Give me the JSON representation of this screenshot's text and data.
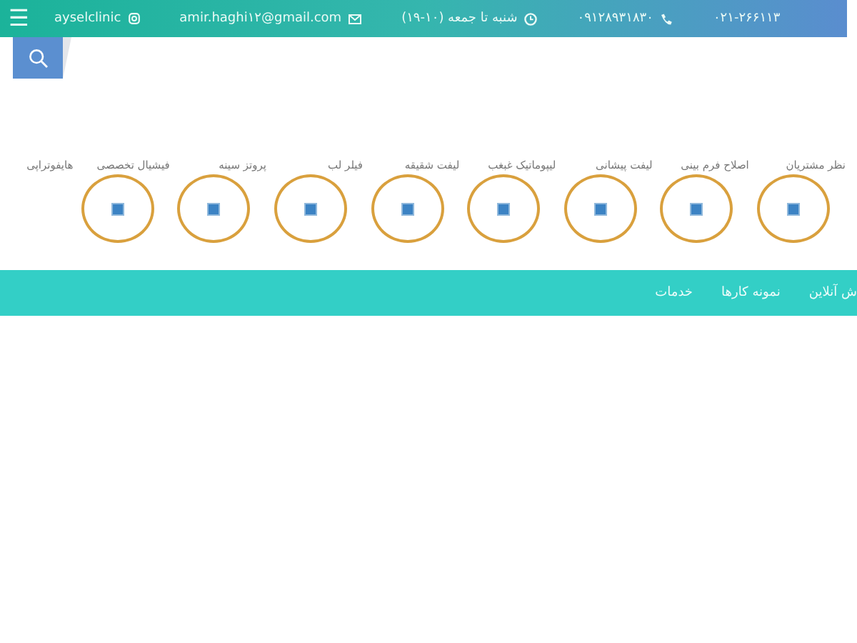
{
  "top_bar": {
    "menu": "☰",
    "instagram": "ayselclinic",
    "email": "amir.haghi۱۲@gmail.com",
    "hours": "شنبه تا جمعه (۱۰-۱۹)",
    "mobile": "۰۹۱۲۸۹۳۱۸۳۰",
    "phone": "۰۲۱-۲۶۶۱۱۳"
  },
  "services": [
    {
      "label": "نظر مشتریان",
      "kind": "circle"
    },
    {
      "label": "اصلاح فرم بینی",
      "kind": "circle"
    },
    {
      "label": "لیفت پیشانی",
      "kind": "circle"
    },
    {
      "label": "لیپوماتیک غبغب",
      "kind": "circle"
    },
    {
      "label": "لیفت شقیقه",
      "kind": "circle"
    },
    {
      "label": "فیلر لب",
      "kind": "circle"
    },
    {
      "label": "پروتز سینه",
      "kind": "circle"
    },
    {
      "label": "فیشیال تخصصی",
      "kind": "circle"
    },
    {
      "label": "هایفوتراپی",
      "kind": "label"
    }
  ],
  "nav": [
    "ش آنلاین",
    "نمونه کارها",
    "خدمات"
  ]
}
